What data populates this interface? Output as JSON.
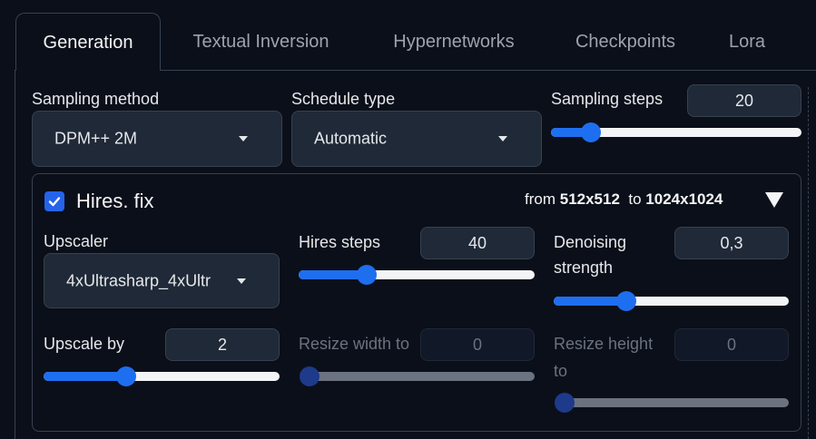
{
  "tabs": [
    {
      "label": "Generation",
      "active": true
    },
    {
      "label": "Textual Inversion",
      "active": false
    },
    {
      "label": "Hypernetworks",
      "active": false
    },
    {
      "label": "Checkpoints",
      "active": false
    },
    {
      "label": "Lora",
      "active": false
    }
  ],
  "sampling_method": {
    "label": "Sampling method",
    "value": "DPM++ 2M"
  },
  "schedule_type": {
    "label": "Schedule type",
    "value": "Automatic"
  },
  "sampling_steps": {
    "label": "Sampling steps",
    "value": "20",
    "fraction": 0.16
  },
  "hires_fix": {
    "label": "Hires. fix",
    "checked": true,
    "info": {
      "from_word": "from",
      "from_size": "512x512",
      "to_word": "to",
      "to_size": "1024x1024"
    },
    "upscaler": {
      "label": "Upscaler",
      "value": "4xUltrasharp_4xUltr"
    },
    "hires_steps": {
      "label": "Hires steps",
      "value": "40",
      "fraction": 0.29
    },
    "denoising": {
      "label_line1": "Denoising",
      "label_line2": "strength",
      "value": "0,3",
      "fraction": 0.31
    },
    "upscale_by": {
      "label": "Upscale by",
      "value": "2",
      "fraction": 0.35
    },
    "resize_width": {
      "label": "Resize width to",
      "value": "0",
      "fraction": 0.0
    },
    "resize_height": {
      "label_line1": "Resize height",
      "label_line2": "to",
      "value": "0",
      "fraction": 0.0
    }
  },
  "colors": {
    "accent": "#1e6ff0",
    "background": "#0b0f19",
    "input": "#1f2937",
    "border": "#374151"
  }
}
